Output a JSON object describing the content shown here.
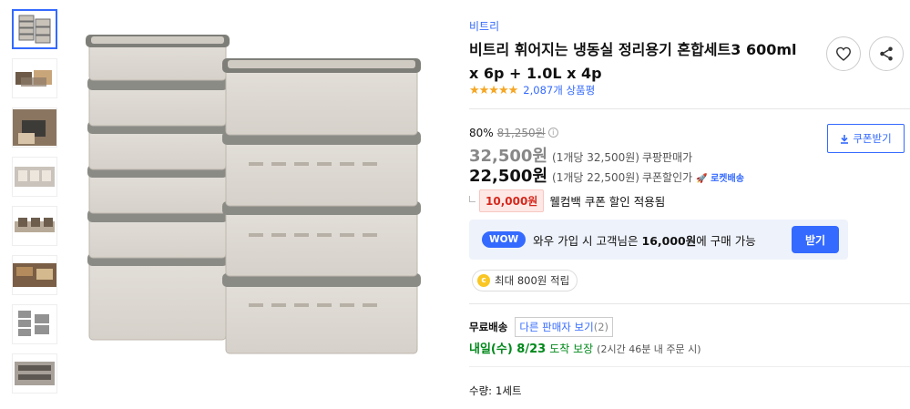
{
  "product": {
    "brand": "비트리",
    "title": "비트리 휘어지는 냉동실 정리용기 혼합세트3 600ml x 6p + 1.0L x 4p",
    "stars": "★★★★★",
    "rating": 4.5,
    "review_count": "2,087개 상품평"
  },
  "price": {
    "discount_rate": "80%",
    "original_price": "81,250원",
    "info_icon": "i",
    "coupang_price": "32,500원",
    "coupang_unit": "(1개당 32,500원)",
    "coupang_label": "쿠팡판매가",
    "coupon_price": "22,500원",
    "coupon_unit": "(1개당 22,500원)",
    "coupon_label": "쿠폰할인가",
    "rocket_label": "로켓배송",
    "coupon_button": "쿠폰받기"
  },
  "welcome": {
    "badge": "10,000원",
    "text": "웰컴백 쿠폰 할인 적용됨"
  },
  "wow": {
    "badge": "WOW",
    "text_prefix": "와우 가입 시 고객님은",
    "amount": "16,000원",
    "text_suffix": "에 구매 가능",
    "button": "받기"
  },
  "cashback": {
    "coin": "c",
    "text": "최대 800원 적립"
  },
  "shipping": {
    "label": "무료배송",
    "other_sellers": "다른 판매자 보기",
    "other_count": "(2)",
    "delivery_date": "내일(수) 8/23",
    "guarantee": "도착 보장",
    "note": "(2시간 46분 내 주문 시)"
  },
  "quantity": {
    "label": "수량:",
    "value": "1세트"
  },
  "icons": {
    "heart": "heart-icon",
    "share": "share-icon",
    "download": "download-icon"
  },
  "colors": {
    "accent": "#346aff",
    "green": "#00891a",
    "red": "#d4281c",
    "star": "#f5a623"
  }
}
